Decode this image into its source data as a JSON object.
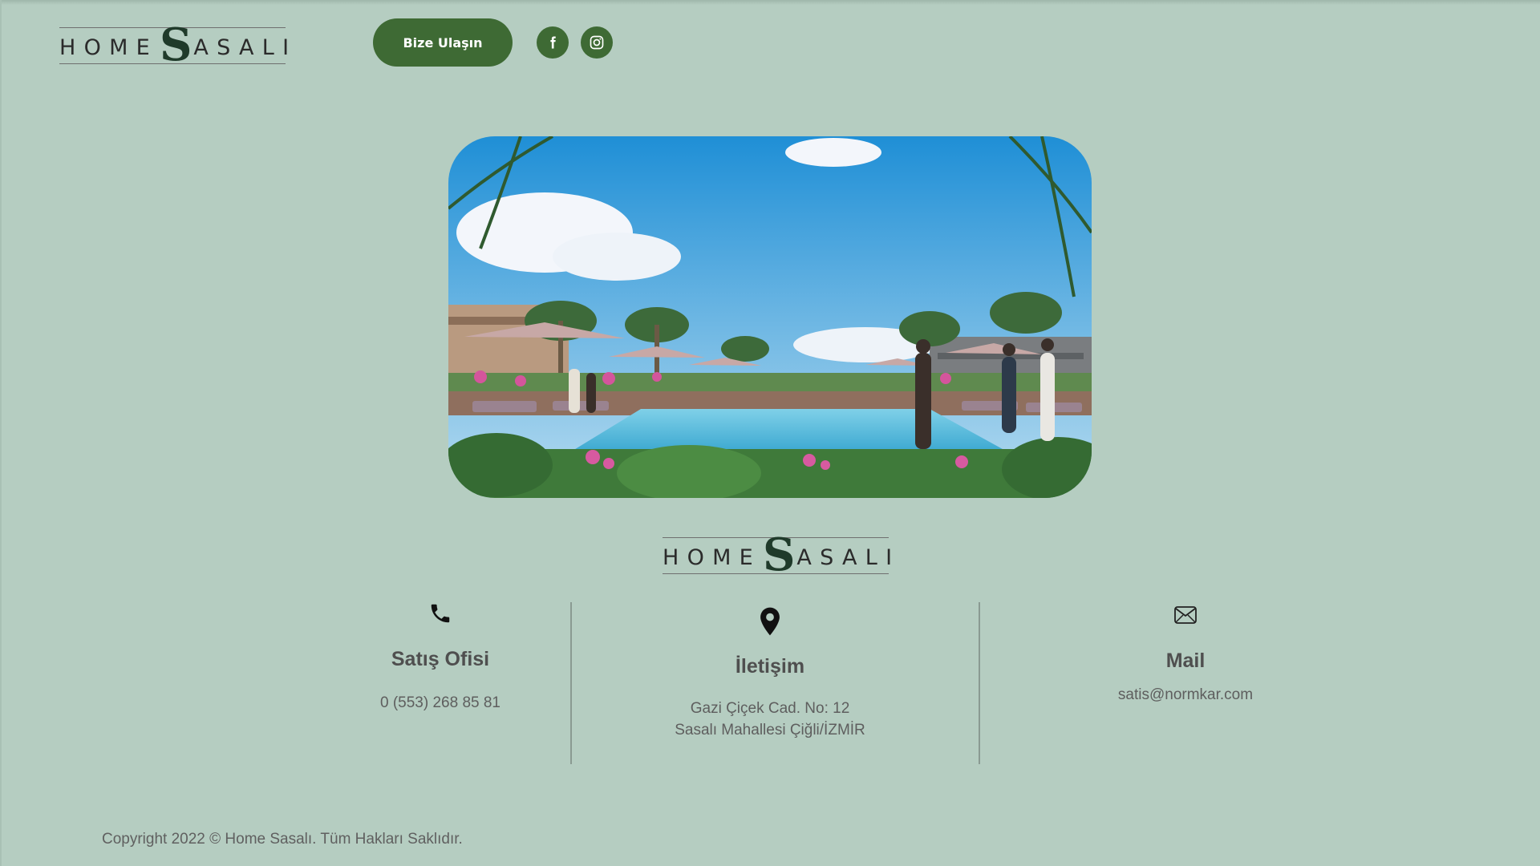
{
  "header": {
    "logo": {
      "word_left": "HOME",
      "monogram": "S",
      "word_right": "ASALI"
    },
    "contact_button": "Bize Ulaşın",
    "social": {
      "facebook_icon": "facebook-icon",
      "instagram_icon": "instagram-icon"
    }
  },
  "hero": {
    "image": "resort-pool-illustration"
  },
  "footer_logo": {
    "word_left": "HOME",
    "monogram": "S",
    "word_right": "ASALI"
  },
  "contact": {
    "sales": {
      "icon": "phone-icon",
      "title": "Satış Ofisi",
      "phone": "0 (553) 268 85 81"
    },
    "address": {
      "icon": "location-pin-icon",
      "title": "İletişim",
      "line1": "Gazi Çiçek Cad. No: 12",
      "line2": "Sasalı Mahallesi Çiğli/İZMİR"
    },
    "mail": {
      "icon": "envelope-icon",
      "title": "Mail",
      "email": "satis@normkar.com"
    }
  },
  "copyright": "Copyright 2022 © Home Sasalı. Tüm Hakları Saklıdır.",
  "colors": {
    "background": "#b5cdc1",
    "brand_green": "#3e6a34"
  }
}
